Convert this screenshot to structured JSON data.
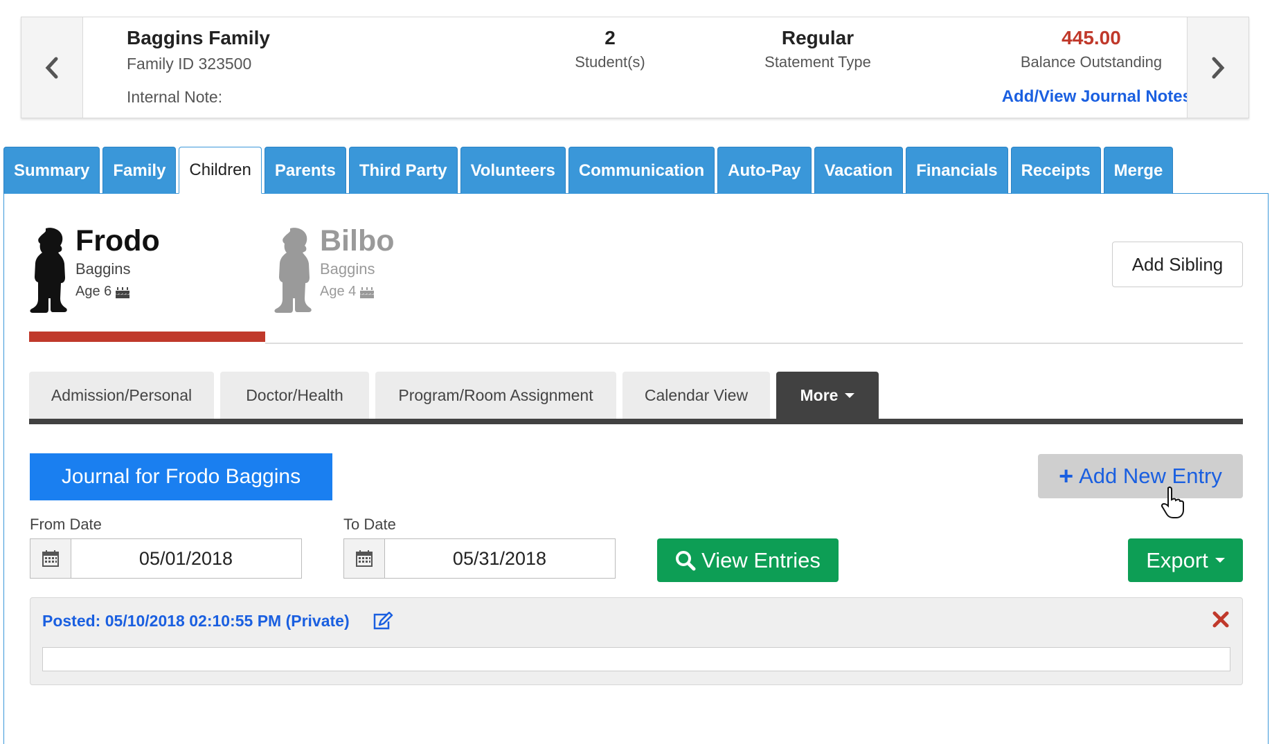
{
  "family": {
    "name": "Baggins Family",
    "id_text": "Family ID 323500",
    "internal_note_label": "Internal Note:",
    "students_value": "2",
    "students_label": "Student(s)",
    "statement_value": "Regular",
    "statement_label": "Statement Type",
    "balance_value": "445.00",
    "balance_label": "Balance Outstanding",
    "journal_link": "Add/View Journal Notes"
  },
  "tabs": [
    "Summary",
    "Family",
    "Children",
    "Parents",
    "Third Party",
    "Volunteers",
    "Communication",
    "Auto-Pay",
    "Vacation",
    "Financials",
    "Receipts",
    "Merge"
  ],
  "active_tab": "Children",
  "children": [
    {
      "first": "Frodo",
      "last": "Baggins",
      "age": "Age 6",
      "selected": true
    },
    {
      "first": "Bilbo",
      "last": "Baggins",
      "age": "Age 4",
      "selected": false
    }
  ],
  "add_sibling_label": "Add Sibling",
  "subtabs": [
    "Admission/Personal",
    "Doctor/Health",
    "Program/Room Assignment",
    "Calendar View"
  ],
  "more_label": "More",
  "journal": {
    "title": "Journal for Frodo Baggins",
    "add_entry_label": "Add New Entry",
    "from_label": "From Date",
    "from_value": "05/01/2018",
    "to_label": "To Date",
    "to_value": "05/31/2018",
    "view_label": "View Entries",
    "export_label": "Export",
    "entry": {
      "posted": "Posted: 05/10/2018 02:10:55 PM (Private)",
      "body": ""
    }
  },
  "colors": {
    "tab_blue": "#3a97d9",
    "link_blue": "#1a5fe0",
    "balance_red": "#c0392b",
    "button_green": "#0d9e55",
    "dark_tab": "#414141"
  }
}
